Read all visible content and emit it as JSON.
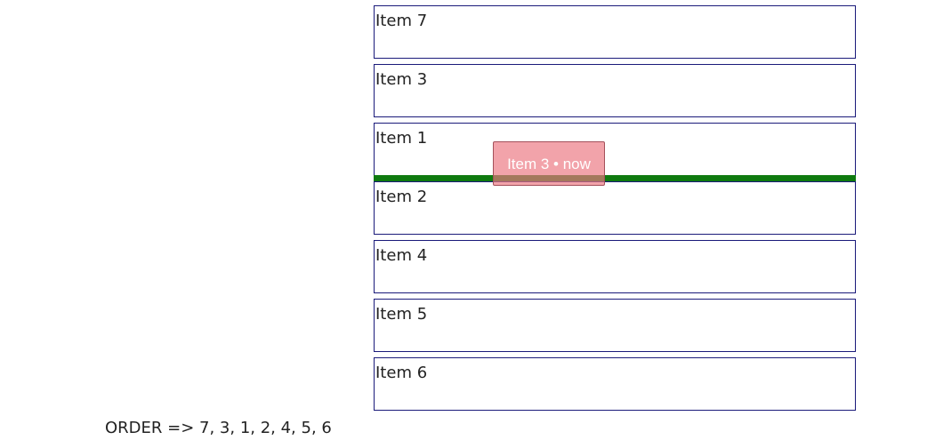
{
  "list": {
    "items": [
      {
        "label": "Item 7"
      },
      {
        "label": "Item 3"
      },
      {
        "label": "Item 1"
      },
      {
        "label": "Item 2"
      },
      {
        "label": "Item 4"
      },
      {
        "label": "Item 5"
      },
      {
        "label": "Item 6"
      }
    ]
  },
  "drag": {
    "ghost_label": "Item 3 • now"
  },
  "order": {
    "text": "ORDER => 7, 3, 1, 2, 4, 5, 6"
  },
  "colors": {
    "item_border": "#1a1a7a",
    "drop_indicator": "#0f7a0f",
    "drag_ghost": "#ec7882"
  }
}
